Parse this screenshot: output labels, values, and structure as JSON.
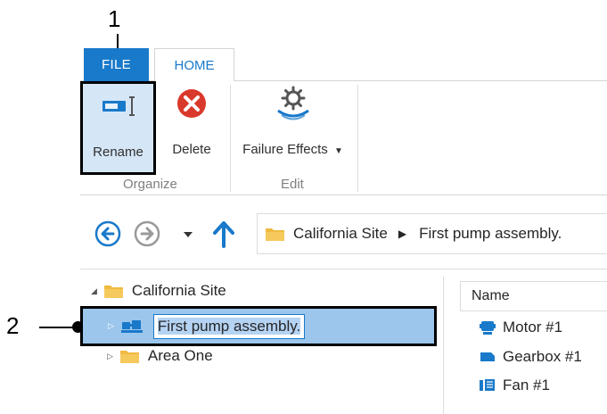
{
  "callouts": {
    "first": "1",
    "second": "2"
  },
  "tabs": {
    "file": "FILE",
    "home": "HOME"
  },
  "ribbon": {
    "rename_label": "Rename",
    "delete_label": "Delete",
    "failure_effects_label": "Failure Effects",
    "group_organize": "Organize",
    "group_edit": "Edit",
    "icons": {
      "rename": "rename-icon",
      "delete": "delete-icon",
      "failure_effects": "gear-icon"
    }
  },
  "nav": {
    "breadcrumb": [
      "California Site",
      "First pump assembly."
    ],
    "icons": {
      "back": "back-arrow-icon",
      "forward": "forward-arrow-icon",
      "dropdown": "dropdown-icon",
      "up": "up-arrow-icon"
    }
  },
  "tree": {
    "root_label": "California Site",
    "selected_label": "First pump assembly.",
    "area_label": "Area One"
  },
  "list": {
    "column_name": "Name",
    "items": [
      "Motor #1",
      "Gearbox #1",
      "Fan #1"
    ]
  },
  "colors": {
    "accent": "#1979ca",
    "selection": "#9cc6ec",
    "folder": "#f0b940",
    "delete": "#d9392c"
  }
}
